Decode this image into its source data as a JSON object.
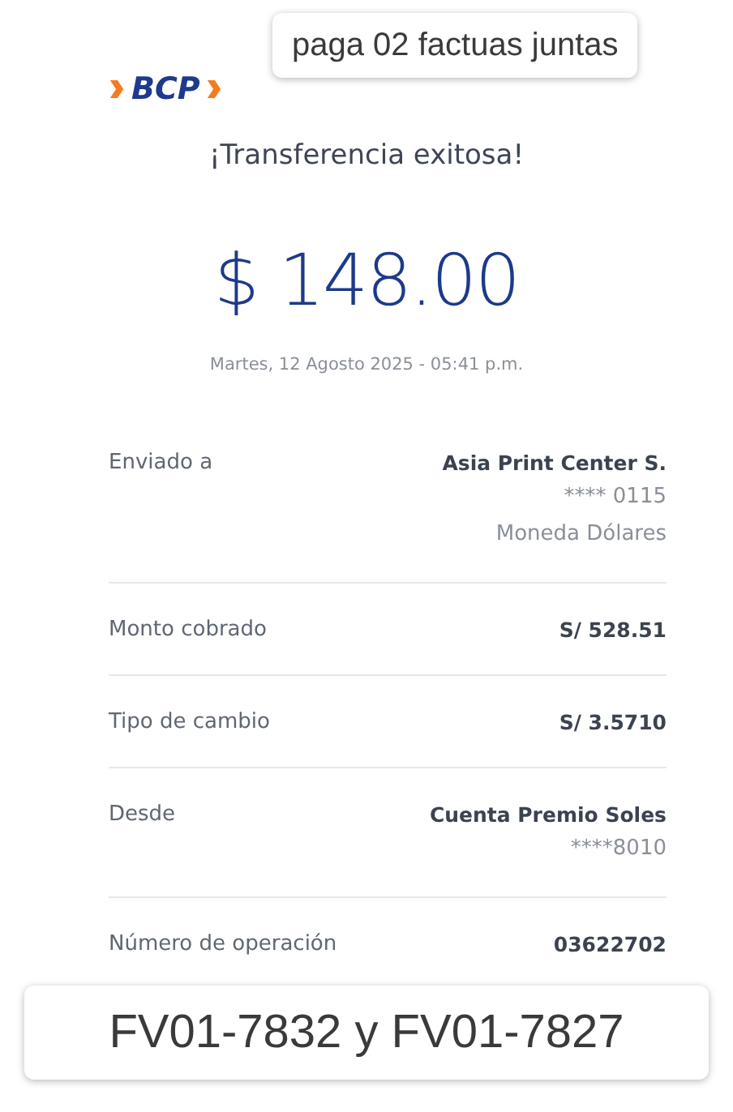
{
  "logo": {
    "text": "BCP"
  },
  "title": "¡Transferencia exitosa!",
  "amount": "$ 148.00",
  "datetime": "Martes, 12 Agosto 2025 - 05:41 p.m.",
  "details": [
    {
      "label": "Enviado a",
      "value": "Asia Print Center S.",
      "sub": [
        "**** 0115",
        "Moneda Dólares"
      ]
    },
    {
      "label": "Monto cobrado",
      "value": "S/ 528.51"
    },
    {
      "label": "Tipo de cambio",
      "value": "S/ 3.5710"
    },
    {
      "label": "Desde",
      "value": "Cuenta Premio Soles",
      "sub": [
        "****8010"
      ]
    },
    {
      "label": "Número de operación",
      "value": "03622702"
    }
  ],
  "notes": [
    {
      "kind": "top",
      "text": "paga 02 factuas juntas"
    },
    {
      "kind": "bottom",
      "text": "FV01-7832 y FV01-7827"
    }
  ]
}
